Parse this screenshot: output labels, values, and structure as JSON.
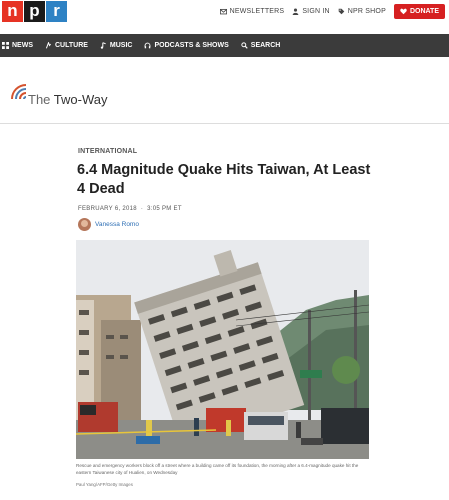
{
  "brand": {
    "letters": [
      "n",
      "p",
      "r"
    ]
  },
  "utilities": {
    "newsletters": "NEWSLETTERS",
    "sign_in": "SIGN IN",
    "shop": "NPR SHOP",
    "donate": "DONATE"
  },
  "nav": {
    "items": [
      {
        "label": "NEWS",
        "icon": "grid-icon"
      },
      {
        "label": "CULTURE",
        "icon": "culture-icon"
      },
      {
        "label": "MUSIC",
        "icon": "music-note-icon"
      },
      {
        "label": "PODCASTS & SHOWS",
        "icon": "headphones-icon"
      },
      {
        "label": "SEARCH",
        "icon": "search-icon"
      }
    ]
  },
  "blog": {
    "the": "The ",
    "name": "Two-Way"
  },
  "article": {
    "kicker": "INTERNATIONAL",
    "headline": "6.4 Magnitude Quake Hits Taiwan, At Least 4 Dead",
    "date": "FEBRUARY 6, 2018",
    "time": "3:05 PM ET",
    "author": "Vanessa Romo",
    "caption": "Rescue and emergency workers block off a street where a building came off its foundation, the morning after a 6.4-magnitude quake hit the eastern Taiwanese city of Hualien, on Wednesday",
    "credit": "Paul Yang/AFP/Getty Images"
  },
  "colors": {
    "npr_red": "#e63324",
    "npr_blue": "#2e82c4",
    "donate_red": "#d62021",
    "nav_bg": "#3b3b3b",
    "link_blue": "#2e6fb5"
  }
}
